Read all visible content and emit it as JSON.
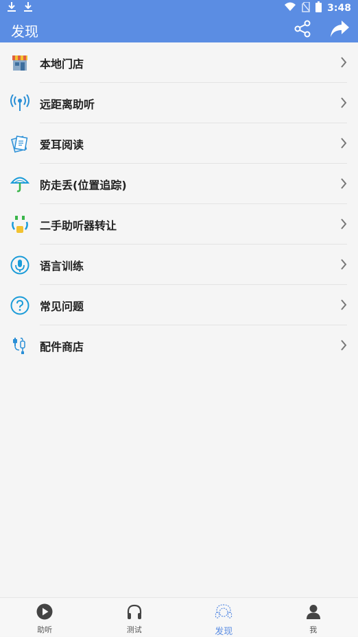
{
  "status": {
    "time": "3:48"
  },
  "appbar": {
    "title": "发现",
    "share_icon": "share-icon",
    "forward_icon": "forward-icon"
  },
  "list": {
    "items": [
      {
        "label": "本地门店",
        "icon": "store-icon"
      },
      {
        "label": "远距离助听",
        "icon": "broadcast-icon"
      },
      {
        "label": "爱耳阅读",
        "icon": "reading-icon"
      },
      {
        "label": "防走丢(位置追踪)",
        "icon": "umbrella-tracking-icon"
      },
      {
        "label": "二手助听器转让",
        "icon": "transfer-icon"
      },
      {
        "label": "语言训练",
        "icon": "microphone-icon"
      },
      {
        "label": "常见问题",
        "icon": "question-icon"
      },
      {
        "label": "配件商店",
        "icon": "accessories-icon"
      }
    ]
  },
  "tabs": [
    {
      "label": "助听",
      "icon": "play-icon"
    },
    {
      "label": "测试",
      "icon": "headphones-icon"
    },
    {
      "label": "发现",
      "icon": "discover-icon",
      "active": true
    },
    {
      "label": "我",
      "icon": "person-icon"
    }
  ],
  "colors": {
    "accent": "#5b8de3"
  }
}
